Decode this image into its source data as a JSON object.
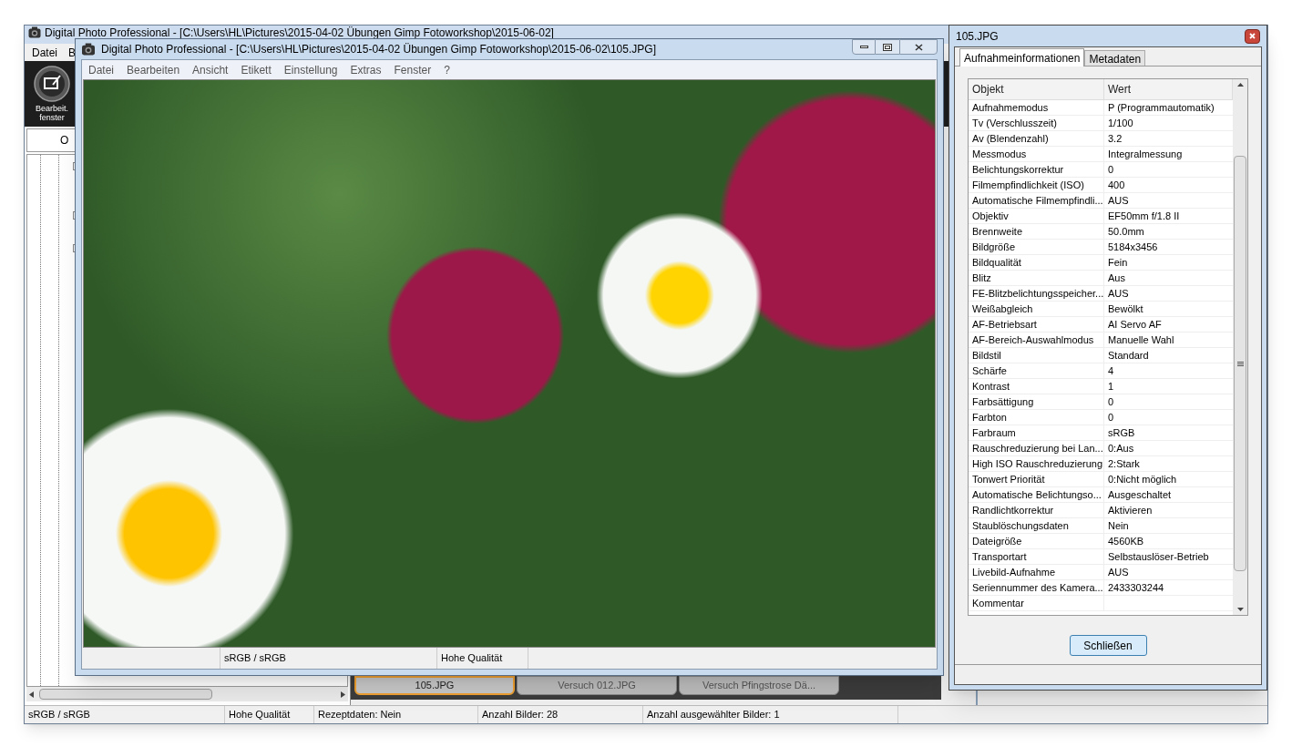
{
  "background_window": {
    "title": "Digital Photo Professional - [C:\\Users\\HL\\Pictures\\2015-04-02 Übungen  Gimp Fotoworkshop\\2015-06-02]",
    "menu": [
      "Datei",
      "B"
    ],
    "toolbar_button": "Bearbeit. fenster",
    "tree_header": "O",
    "thumbnail_tabs": [
      {
        "label": "105.JPG",
        "selected": true
      },
      {
        "label": "Versuch 012.JPG",
        "selected": false
      },
      {
        "label": "Versuch Pfingstrose Dä...",
        "selected": false
      }
    ],
    "status_bar": [
      "sRGB / sRGB",
      "Hohe Qualität",
      "Rezeptdaten: Nein",
      "Anzahl Bilder: 28",
      "Anzahl ausgewählter Bilder: 1"
    ]
  },
  "image_window": {
    "title": "Digital Photo Professional - [C:\\Users\\HL\\Pictures\\2015-04-02 Übungen  Gimp Fotoworkshop\\2015-06-02\\105.JPG]",
    "menu": [
      "Datei",
      "Bearbeiten",
      "Ansicht",
      "Etikett",
      "Einstellung",
      "Extras",
      "Fenster",
      "?"
    ],
    "status_bar": [
      "sRGB / sRGB",
      "Hohe Qualität"
    ]
  },
  "dialog": {
    "title": "105.JPG",
    "tabs": [
      {
        "label": "Aufnahmeinformationen",
        "selected": true
      },
      {
        "label": "Metadaten",
        "selected": false
      }
    ],
    "columns": [
      "Objekt",
      "Wert"
    ],
    "rows": [
      {
        "item": "Aufnahmemodus",
        "value": "P (Programmautomatik)"
      },
      {
        "item": "Tv (Verschlusszeit)",
        "value": "1/100"
      },
      {
        "item": "Av (Blendenzahl)",
        "value": "3.2"
      },
      {
        "item": "Messmodus",
        "value": "Integralmessung"
      },
      {
        "item": "Belichtungskorrektur",
        "value": "0"
      },
      {
        "item": "Filmempfindlichkeit (ISO)",
        "value": "400"
      },
      {
        "item": "Automatische Filmempfindli...",
        "value": "AUS"
      },
      {
        "item": "Objektiv",
        "value": "EF50mm f/1.8 II"
      },
      {
        "item": "Brennweite",
        "value": "50.0mm"
      },
      {
        "item": "Bildgröße",
        "value": "5184x3456"
      },
      {
        "item": "Bildqualität",
        "value": "Fein"
      },
      {
        "item": "Blitz",
        "value": "Aus"
      },
      {
        "item": "FE-Blitzbelichtungsspeicher...",
        "value": "AUS"
      },
      {
        "item": "Weißabgleich",
        "value": "Bewölkt"
      },
      {
        "item": "AF-Betriebsart",
        "value": "AI Servo AF"
      },
      {
        "item": "AF-Bereich-Auswahlmodus",
        "value": "Manuelle  Wahl"
      },
      {
        "item": "Bildstil",
        "value": "Standard"
      },
      {
        "item": "Schärfe",
        "value": "4"
      },
      {
        "item": "Kontrast",
        "value": "1"
      },
      {
        "item": "Farbsättigung",
        "value": "0"
      },
      {
        "item": "Farbton",
        "value": "0"
      },
      {
        "item": "Farbraum",
        "value": "sRGB"
      },
      {
        "item": "Rauschreduzierung bei Lan...",
        "value": "0:Aus"
      },
      {
        "item": "High ISO Rauschreduzierung",
        "value": "2:Stark"
      },
      {
        "item": "Tonwert Priorität",
        "value": "0:Nicht möglich"
      },
      {
        "item": "Automatische Belichtungso...",
        "value": "Ausgeschaltet"
      },
      {
        "item": "Randlichtkorrektur",
        "value": "Aktivieren"
      },
      {
        "item": "Staublöschungsdaten",
        "value": "Nein"
      },
      {
        "item": "Dateigröße",
        "value": "4560KB"
      },
      {
        "item": "Transportart",
        "value": "Selbstauslöser-Betrieb"
      },
      {
        "item": "Livebild-Aufnahme",
        "value": "AUS"
      },
      {
        "item": "Seriennummer des Kamera...",
        "value": "2433303244"
      },
      {
        "item": "Kommentar"
      }
    ],
    "button": "Schließen"
  }
}
